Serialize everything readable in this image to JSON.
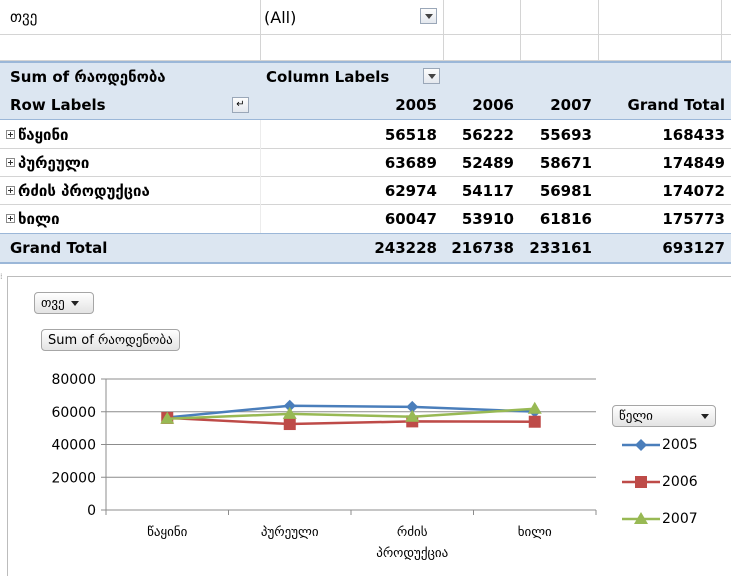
{
  "pivot": {
    "filter": {
      "field": "თვე",
      "value": "(All)"
    },
    "value_field": "Sum of რაოდენობა",
    "column_labels": "Column Labels",
    "row_labels": "Row Labels",
    "columns": [
      "2005",
      "2006",
      "2007",
      "Grand Total"
    ],
    "rows": [
      {
        "label": "წაყინი",
        "values": [
          "56518",
          "56222",
          "55693",
          "168433"
        ]
      },
      {
        "label": "პურეული",
        "values": [
          "63689",
          "52489",
          "58671",
          "174849"
        ]
      },
      {
        "label": "რძის პროდუქცია",
        "values": [
          "62974",
          "54117",
          "56981",
          "174072"
        ]
      },
      {
        "label": "ხილი",
        "values": [
          "60047",
          "53910",
          "61816",
          "175773"
        ]
      }
    ],
    "grand_total": {
      "label": "Grand Total",
      "values": [
        "243228",
        "216738",
        "233161",
        "693127"
      ]
    }
  },
  "chart": {
    "filter_button": "თვე",
    "value_button": "Sum of რაოდენობა",
    "legend_button": "წელი",
    "colors": {
      "2005": "#4a7ebb",
      "2006": "#be4b48",
      "2007": "#98b954"
    }
  },
  "chart_data": {
    "type": "line",
    "categories": [
      "წაყინი",
      "პურეული",
      "რძის\nპროდუქცია",
      "ხილი"
    ],
    "series": [
      {
        "name": "2005",
        "values": [
          56518,
          63689,
          62974,
          60047
        ]
      },
      {
        "name": "2006",
        "values": [
          56222,
          52489,
          54117,
          53910
        ]
      },
      {
        "name": "2007",
        "values": [
          55693,
          58671,
          56981,
          61816
        ]
      }
    ],
    "yticks": [
      "0",
      "20000",
      "40000",
      "60000",
      "80000"
    ],
    "ylim": [
      0,
      80000
    ],
    "grid": true,
    "legend": "right"
  }
}
